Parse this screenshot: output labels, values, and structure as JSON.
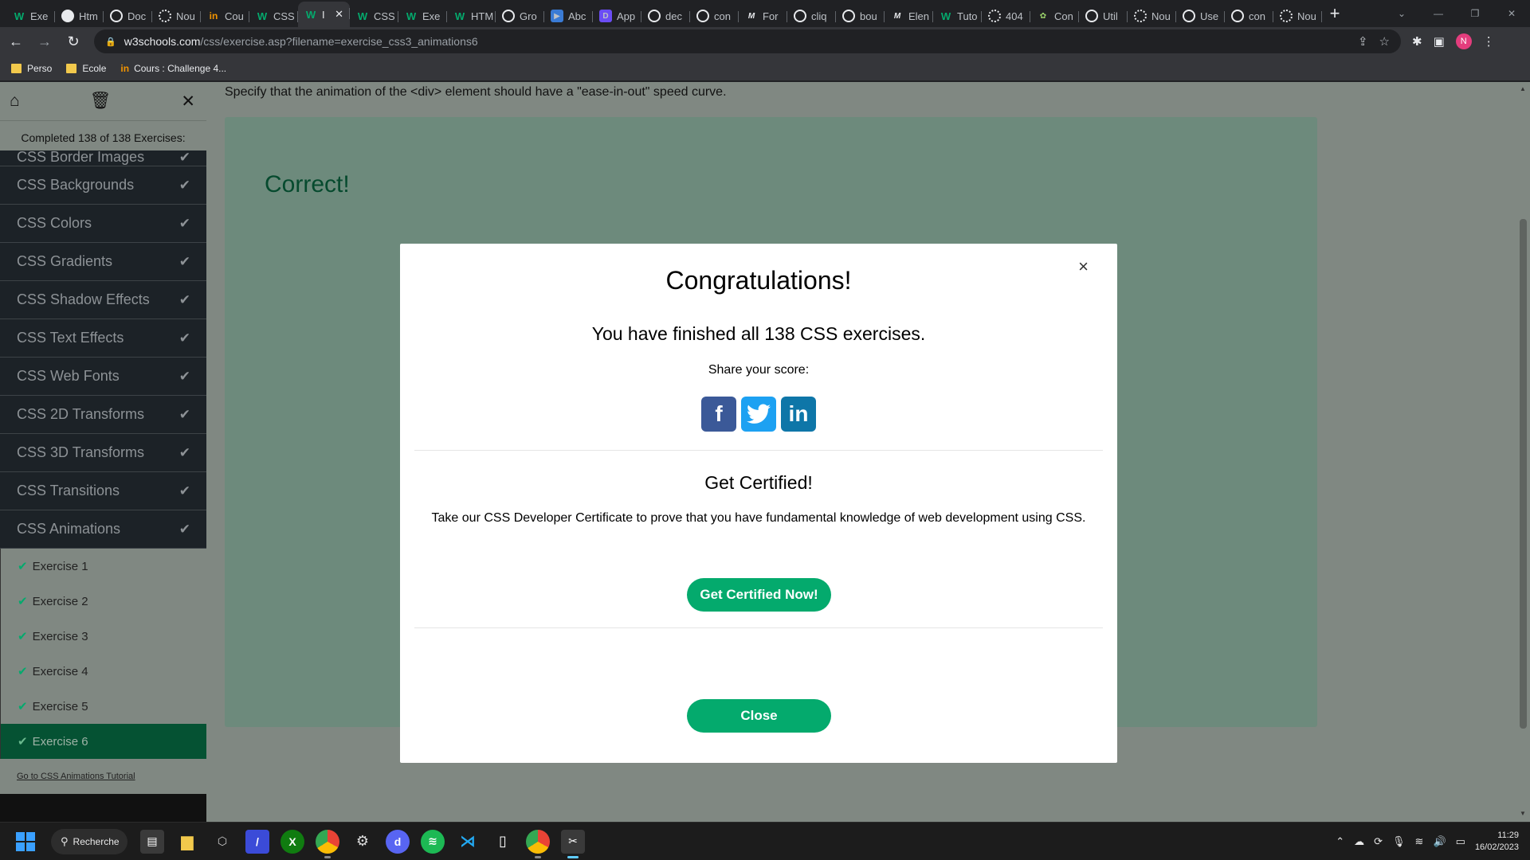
{
  "browser": {
    "tabs": [
      {
        "label": "Exe",
        "icon": "w3schools-icon",
        "glyph": "W",
        "cls": "w3"
      },
      {
        "label": "Htm",
        "icon": "github-icon",
        "glyph": "",
        "cls": "gh"
      },
      {
        "label": "Doc",
        "icon": "globe-icon",
        "glyph": "",
        "cls": "g"
      },
      {
        "label": "Nou",
        "icon": "gear-icon",
        "glyph": "",
        "cls": "gear"
      },
      {
        "label": "Cou",
        "icon": "openclassrooms-icon",
        "glyph": "in",
        "cls": "oc"
      },
      {
        "label": "CSS",
        "icon": "w3schools-icon",
        "glyph": "W",
        "cls": "w3"
      },
      {
        "label": "I",
        "icon": "w3schools-icon",
        "glyph": "W",
        "cls": "w3",
        "active": true
      },
      {
        "label": "CSS",
        "icon": "w3schools-icon",
        "glyph": "W",
        "cls": "w3"
      },
      {
        "label": "Exe",
        "icon": "w3schools-icon",
        "glyph": "W",
        "cls": "w3"
      },
      {
        "label": "HTM",
        "icon": "w3schools-icon",
        "glyph": "W",
        "cls": "w3"
      },
      {
        "label": "Gro",
        "icon": "globe-icon",
        "glyph": "",
        "cls": "g"
      },
      {
        "label": "Abc",
        "icon": "video-icon",
        "glyph": "▶",
        "cls": "yt"
      },
      {
        "label": "App",
        "icon": "app-icon",
        "glyph": "D",
        "cls": "ai"
      },
      {
        "label": "dec",
        "icon": "google-icon",
        "glyph": "",
        "cls": "g"
      },
      {
        "label": "con",
        "icon": "google-icon",
        "glyph": "",
        "cls": "g"
      },
      {
        "label": "For",
        "icon": "medium-icon",
        "glyph": "M",
        "cls": "m"
      },
      {
        "label": "cliq",
        "icon": "google-icon",
        "glyph": "",
        "cls": "g"
      },
      {
        "label": "bou",
        "icon": "google-icon",
        "glyph": "",
        "cls": "g"
      },
      {
        "label": "Elen",
        "icon": "medium-icon",
        "glyph": "M",
        "cls": "m"
      },
      {
        "label": "Tuto",
        "icon": "w3schools-icon",
        "glyph": "W",
        "cls": "w3"
      },
      {
        "label": "404",
        "icon": "gear-icon",
        "glyph": "",
        "cls": "gear"
      },
      {
        "label": "Con",
        "icon": "leaf-icon",
        "glyph": "✿",
        "cls": "leaf"
      },
      {
        "label": "Util",
        "icon": "google-icon",
        "glyph": "",
        "cls": "g"
      },
      {
        "label": "Nou",
        "icon": "gear-icon",
        "glyph": "",
        "cls": "gear"
      },
      {
        "label": "Use",
        "icon": "google-icon",
        "glyph": "",
        "cls": "g"
      },
      {
        "label": "con",
        "icon": "google-icon",
        "glyph": "",
        "cls": "g"
      },
      {
        "label": "Nou",
        "icon": "gear-icon",
        "glyph": "",
        "cls": "gear"
      }
    ],
    "url_host": "w3schools.com",
    "url_path": "/css/exercise.asp?filename=exercise_css3_animations6",
    "bookmarks": [
      {
        "label": "Perso",
        "type": "folder"
      },
      {
        "label": "Ecole",
        "type": "folder"
      },
      {
        "label": "Cours : Challenge 4...",
        "type": "openclassrooms"
      }
    ],
    "profile_initial": "N"
  },
  "sidebar": {
    "completed_text": "Completed 138 of 138 Exercises:",
    "partial_category": "CSS Border Images",
    "categories": [
      "CSS Backgrounds",
      "CSS Colors",
      "CSS Gradients",
      "CSS Shadow Effects",
      "CSS Text Effects",
      "CSS Web Fonts",
      "CSS 2D Transforms",
      "CSS 3D Transforms",
      "CSS Transitions",
      "CSS Animations"
    ],
    "exercises": [
      "Exercise 1",
      "Exercise 2",
      "Exercise 3",
      "Exercise 4",
      "Exercise 5",
      "Exercise 6"
    ],
    "current_exercise": 6,
    "tutorial_link": "Go to CSS Animations Tutorial"
  },
  "main": {
    "instruction": "Specify that the animation of the <div> element should have a \"ease-in-out\" speed curve.",
    "result": "Correct!"
  },
  "modal": {
    "close_x": "×",
    "title": "Congratulations!",
    "subtitle": "You have finished all 138 CSS exercises.",
    "share_label": "Share your score:",
    "cert_title": "Get Certified!",
    "cert_text": "Take our CSS Developer Certificate to prove that you have fundamental knowledge of web development using CSS.",
    "cert_button": "Get Certified Now!",
    "close_button": "Close"
  },
  "taskbar": {
    "search_label": "Recherche",
    "time": "11:29",
    "date": "16/02/2023"
  },
  "colors": {
    "accent": "#04aa6d",
    "overlay": "#808882",
    "sidebar_dark": "#1c2227"
  }
}
